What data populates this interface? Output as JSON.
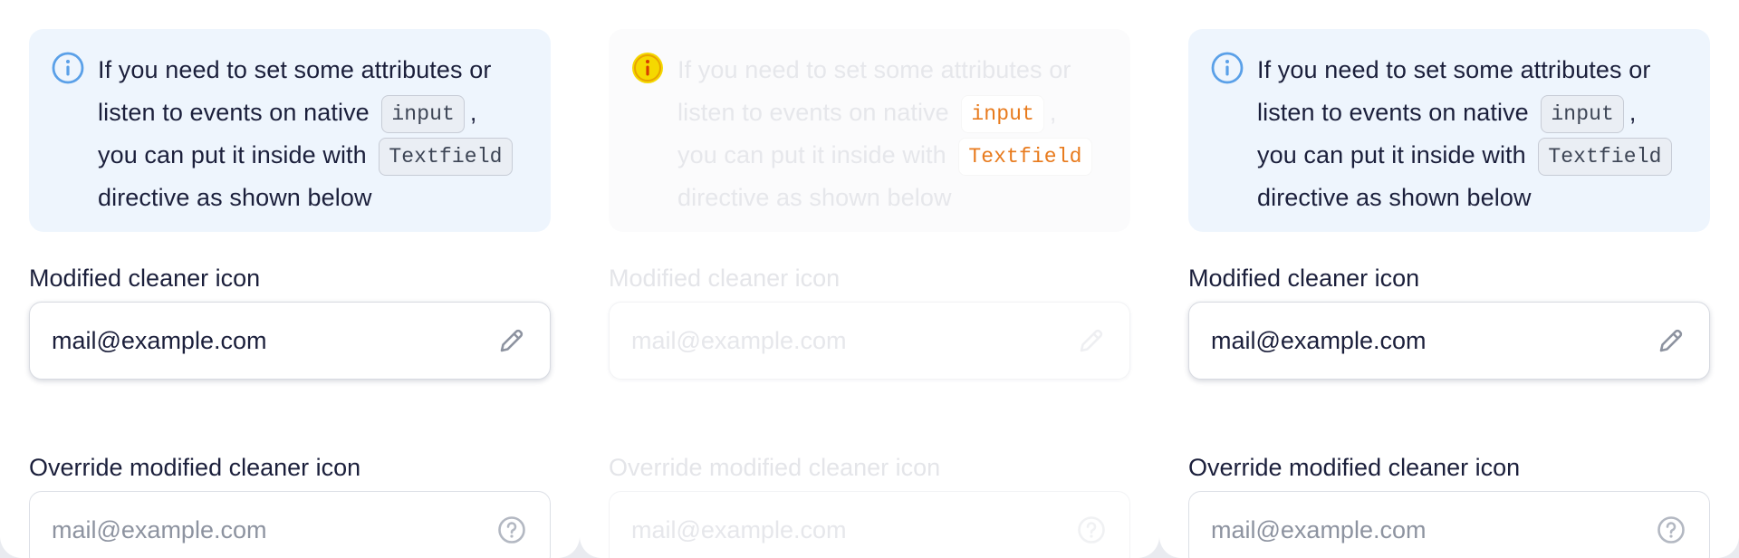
{
  "notice": {
    "line_a": "If you need to set some attributes or listen to events on native",
    "code_input": "input",
    "line_b": ",",
    "line_c": "you can put it inside with",
    "code_textfield": "Textfield",
    "line_d": "directive as shown below"
  },
  "field_one": {
    "label": "Modified cleaner icon",
    "value": "mail@example.com",
    "icon": "pencil-icon"
  },
  "field_two": {
    "label": "Override modified cleaner icon",
    "placeholder": "mail@example.com",
    "icon": "question-circle-icon"
  },
  "colors": {
    "info_accent": "#5aa0e8",
    "notice_bg": "#eef5fd",
    "text": "#1b1f3b",
    "placeholder": "#8d93a0",
    "code_highlight": "#e87b1e",
    "warning_icon": "#f5d800"
  }
}
